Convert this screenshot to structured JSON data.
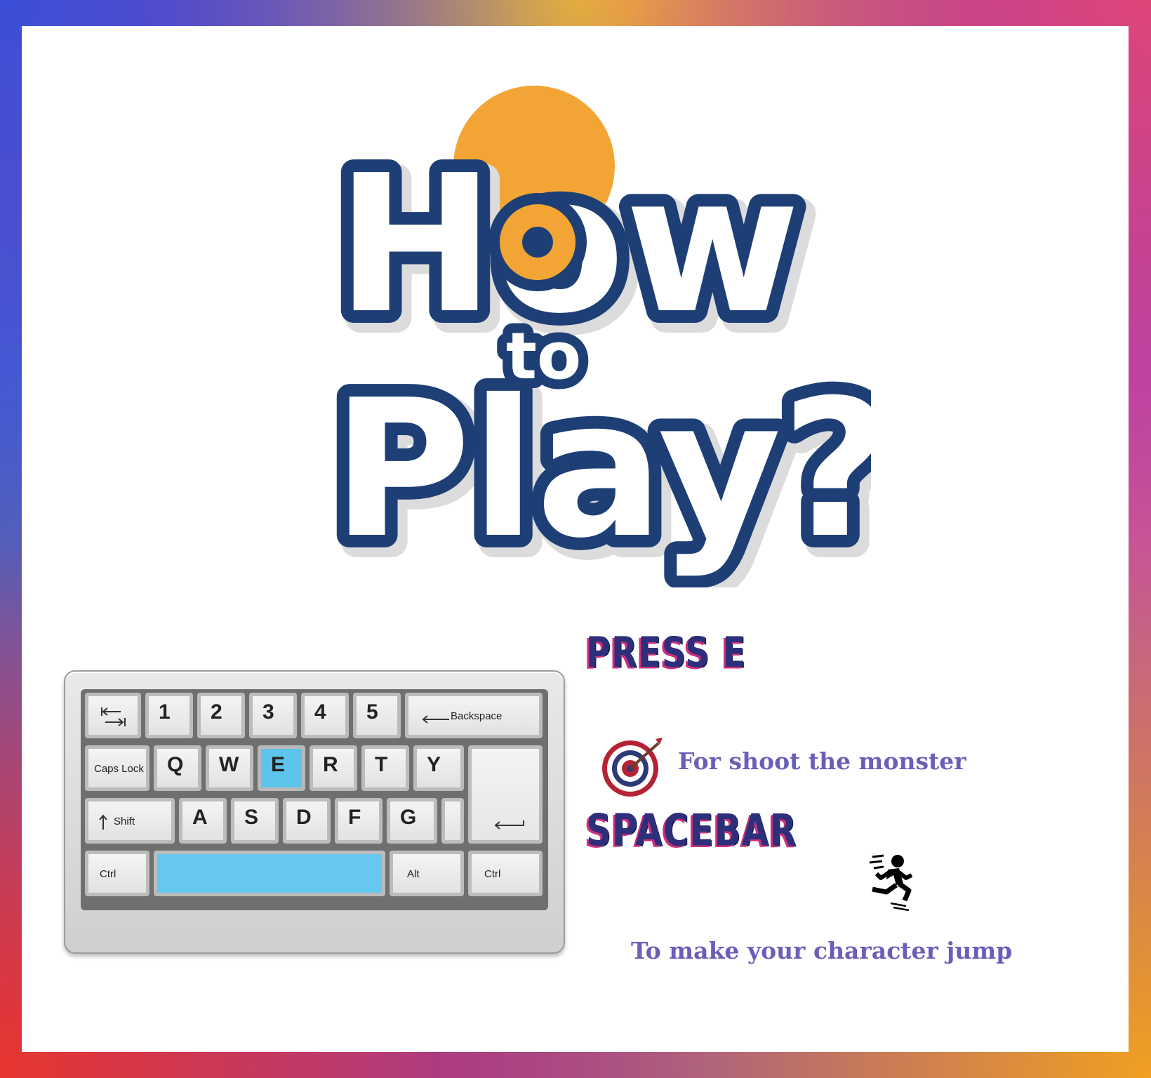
{
  "logo": {
    "line1": "How",
    "line2": "to",
    "line3": "Play?",
    "colors": {
      "fill": "#ffffff",
      "outline": "#1e3f75",
      "accent": "#f0a030"
    }
  },
  "keyboard": {
    "row1": [
      "tab-icon",
      "1",
      "2",
      "3",
      "4",
      "5",
      "Backspace"
    ],
    "row2": [
      "Caps Lock",
      "Q",
      "W",
      "E",
      "R",
      "T",
      "Y"
    ],
    "row3": [
      "Shift",
      "A",
      "S",
      "D",
      "F",
      "G",
      "enter-icon"
    ],
    "row4": [
      "Ctrl",
      "",
      "Alt",
      "Ctrl"
    ],
    "highlighted_keys": [
      "E",
      "spacebar"
    ],
    "highlight_color": "#5dc4ec"
  },
  "instructions": {
    "press_e": {
      "heading": "PRESS E",
      "icon": "target-icon",
      "description": "For shoot the monster"
    },
    "spacebar": {
      "heading": "SPACEBAR",
      "icon": "running-person-icon",
      "description": "To make your character jump"
    },
    "colors": {
      "heading": "#2d2f7a",
      "heading_shadow": "#d02f7c",
      "description": "#6a5fb8"
    }
  }
}
